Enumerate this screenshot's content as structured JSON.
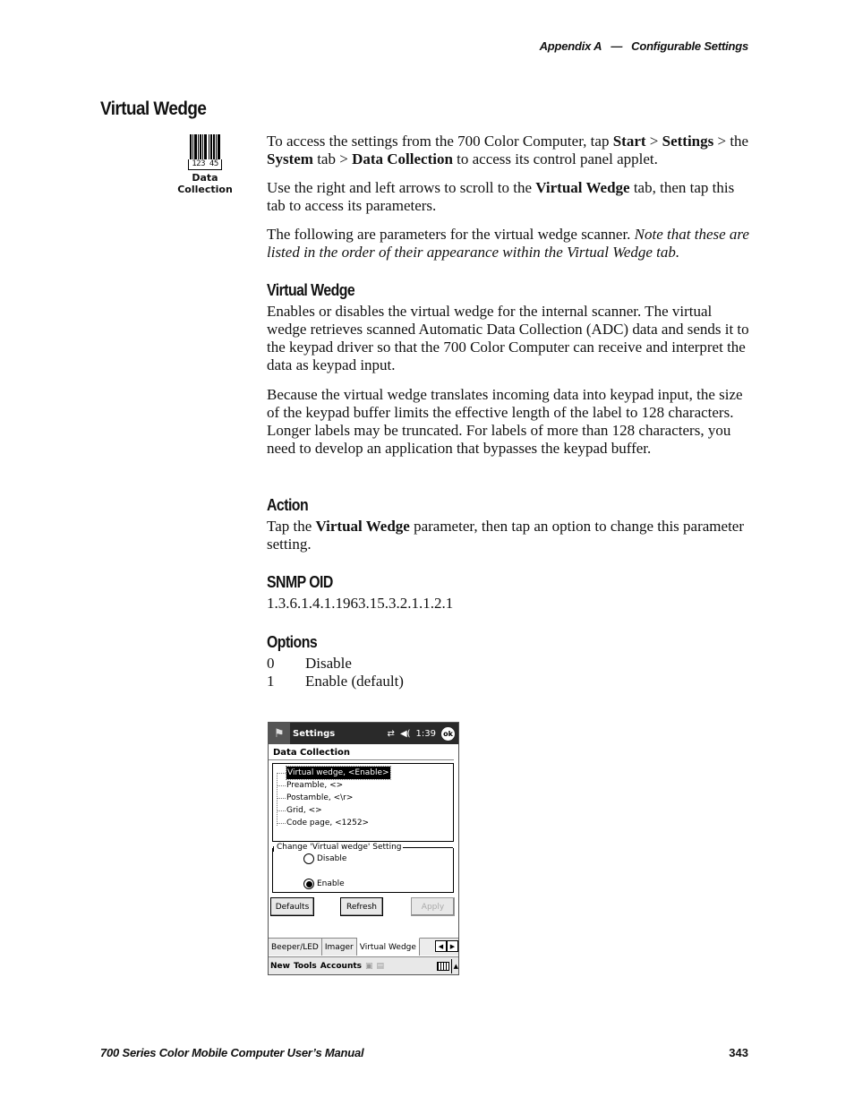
{
  "running_head": {
    "appendix": "Appendix A",
    "dash": "—",
    "chapter": "Configurable Settings"
  },
  "section_title": "Virtual Wedge",
  "applet": {
    "icon": "barcode-icon",
    "barcode_digits": "123 45",
    "label_line1": "Data",
    "label_line2": "Collection"
  },
  "intro": {
    "p1": {
      "t1": "To access the settings from the 700 Color Computer, tap ",
      "b1": "Start",
      "t2": " > ",
      "b2": "Settings",
      "t3": " > the ",
      "b3": "System",
      "t4": " tab > ",
      "b4": "Data Collection",
      "t5": " to access its control panel applet."
    },
    "p2": {
      "t1": "Use the right and left arrows to scroll to the ",
      "b1": "Virtual Wedge",
      "t2": " tab, then tap this tab to access its parameters."
    },
    "p3": {
      "t1": "The following are parameters for the virtual wedge scanner. ",
      "i1": "Note that these are listed in the order of their appearance within the Virtual Wedge tab."
    }
  },
  "parameter": {
    "heading": "Virtual Wedge",
    "p1": "Enables or disables the virtual wedge for the internal scanner. The virtual wedge retrieves scanned Automatic Data Collection (ADC) data and sends it to the keypad driver so that the 700 Color Computer can receive and interpret the data as keypad input.",
    "p2": "Because the virtual wedge translates incoming data into keypad input, the size of the keypad buffer limits the effective length of the label to 128 characters. Longer labels may be truncated. For labels of more than 128 characters, you need to develop an application that bypasses the keypad buffer."
  },
  "action": {
    "heading": "Action",
    "t1": "Tap the ",
    "b1": "Virtual Wedge",
    "t2": " parameter, then tap an option to change this parameter setting."
  },
  "snmp": {
    "heading": "SNMP OID",
    "value": "1.3.6.1.4.1.1963.15.3.2.1.1.2.1"
  },
  "options": {
    "heading": "Options",
    "items": [
      {
        "num": "0",
        "label": "Disable"
      },
      {
        "num": "1",
        "label": "Enable (default)"
      }
    ]
  },
  "device": {
    "titlebar": {
      "start_icon": "windows-flag-icon",
      "title": "Settings",
      "connectivity_icon": "sync-arrows-icon",
      "volume_icon": "speaker-icon",
      "time": "1:39",
      "ok_label": "ok"
    },
    "panel_title": "Data Collection",
    "tree_items": [
      {
        "label": "Virtual wedge, <Enable>",
        "selected": true
      },
      {
        "label": "Preamble, <>",
        "selected": false
      },
      {
        "label": "Postamble, <\\r>",
        "selected": false
      },
      {
        "label": "Grid, <>",
        "selected": false
      },
      {
        "label": "Code page, <1252>",
        "selected": false
      }
    ],
    "group_label": "Change 'Virtual wedge' Setting",
    "radios": [
      {
        "label": "Disable",
        "checked": false
      },
      {
        "label": "Enable",
        "checked": true
      }
    ],
    "buttons": {
      "defaults": "Defaults",
      "refresh": "Refresh",
      "apply": "Apply"
    },
    "tabs": [
      "Beeper/LED",
      "Imager",
      "Virtual Wedge"
    ],
    "active_tab": "Virtual Wedge",
    "menubar": {
      "items": [
        "New",
        "Tools",
        "Accounts"
      ],
      "keyboard_icon": "keyboard-icon"
    }
  },
  "footer": {
    "manual_title": "700 Series Color Mobile Computer User’s Manual",
    "page_number": "343"
  }
}
